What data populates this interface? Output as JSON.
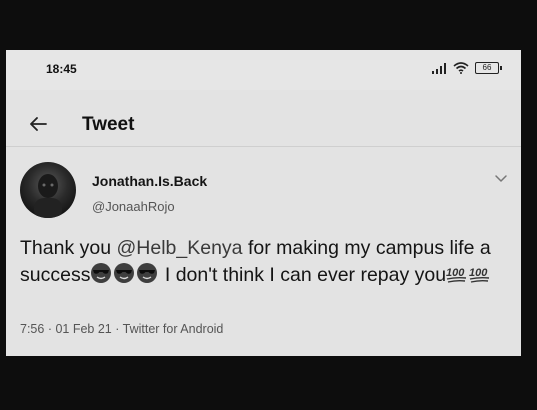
{
  "status_bar": {
    "time": "18:45",
    "battery_level": "66",
    "signal_icon": "signal-bars-icon",
    "wifi_icon": "wifi-icon"
  },
  "header": {
    "back_icon": "arrow-left-icon",
    "title": "Tweet"
  },
  "tweet": {
    "author": {
      "display_name": "Jonathan.Is.Back",
      "handle": "@JonaahRojo"
    },
    "text_parts": {
      "p1": "Thank you ",
      "mention": "@Helb_Kenya",
      "p2": "  for making my campus life a success",
      "p3": " I don't think I can ever repay you"
    },
    "emojis": [
      "smiling-face-with-sunglasses",
      "smiling-face-with-sunglasses",
      "smiling-face-with-sunglasses",
      "hundred-points",
      "hundred-points"
    ],
    "meta": {
      "time": "7:56",
      "sep1": " · ",
      "date": "01 Feb 21",
      "sep2": " · ",
      "source": "Twitter for Android"
    }
  }
}
